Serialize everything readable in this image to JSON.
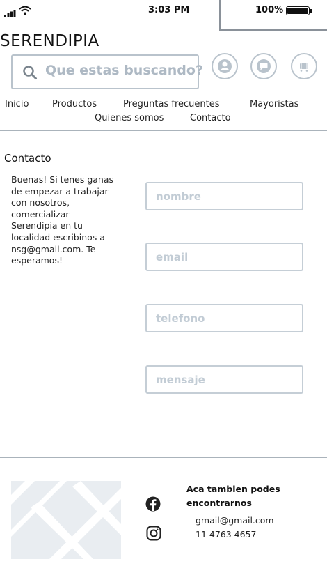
{
  "status_bar": {
    "time": "3:03 PM",
    "battery": "100%"
  },
  "brand": "SERENDIPIA",
  "search": {
    "placeholder": "Que estas buscando?"
  },
  "header_icons": [
    "user-icon",
    "chat-icon",
    "cart-icon"
  ],
  "nav": {
    "row1": [
      "Inicio",
      "Productos",
      "Preguntas frecuentes",
      "Mayoristas"
    ],
    "row2": [
      "Quienes somos",
      "Contacto"
    ]
  },
  "contact": {
    "title": "Contacto",
    "lines": [
      "Buenas! Si tenes ganas",
      "de empezar a trabajar",
      "con nosotros,",
      "comercializar",
      "Serendipia en tu",
      "localidad escribinos a",
      "nsg@gmail.com. Te",
      "esperamos!"
    ],
    "fields": [
      {
        "placeholder": "nombre"
      },
      {
        "placeholder": "email"
      },
      {
        "placeholder": "telefono"
      },
      {
        "placeholder": "mensaje"
      }
    ]
  },
  "footer": {
    "heading_line1": "Aca tambien podes",
    "heading_line2": "encontrarnos",
    "email": "gmail@gmail.com",
    "phone": "11 4763 4657",
    "social_icons": [
      "facebook-icon",
      "instagram-icon"
    ]
  },
  "colors": {
    "accent_gray": "#b9c3cc",
    "divider": "#aab3bb",
    "placeholder": "#c2ccd5"
  }
}
